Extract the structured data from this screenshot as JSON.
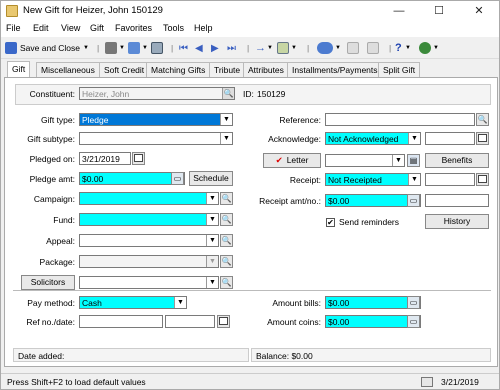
{
  "window": {
    "title": "New Gift for Heizer, John 150129",
    "minimize": "—",
    "maximize": "☐",
    "close": "✕"
  },
  "menu": [
    "File",
    "Edit",
    "View",
    "Gift",
    "Favorites",
    "Tools",
    "Help"
  ],
  "toolbar": {
    "save_close": "Save and Close"
  },
  "tabs": [
    "Gift",
    "Miscellaneous",
    "Soft Credit",
    "Matching Gifts",
    "Tribute",
    "Attributes",
    "Installments/Payments",
    "Split Gift"
  ],
  "constituent": {
    "label": "Constituent:",
    "value": "Heizer, John",
    "id_label": "ID:",
    "id_value": "150129"
  },
  "left": {
    "gift_type": {
      "label": "Gift type:",
      "value": "Pledge"
    },
    "gift_subtype": {
      "label": "Gift subtype:",
      "value": ""
    },
    "pledged_on": {
      "label": "Pledged on:",
      "value": "3/21/2019"
    },
    "pledge_amt": {
      "label": "Pledge amt:",
      "value": "$0.00",
      "schedule": "Schedule"
    },
    "campaign": {
      "label": "Campaign:",
      "value": ""
    },
    "fund": {
      "label": "Fund:",
      "value": ""
    },
    "appeal": {
      "label": "Appeal:",
      "value": ""
    },
    "package": {
      "label": "Package:",
      "value": ""
    },
    "solicitors": {
      "label": "Solicitors",
      "value": ""
    }
  },
  "right": {
    "reference": {
      "label": "Reference:",
      "value": ""
    },
    "acknowledge": {
      "label": "Acknowledge:",
      "value": "Not Acknowledged",
      "date": ""
    },
    "letter": {
      "label": "Letter",
      "value": "",
      "benefits": "Benefits"
    },
    "receipt": {
      "label": "Receipt:",
      "value": "Not Receipted",
      "date": ""
    },
    "receipt_amt": {
      "label": "Receipt amt/no.:",
      "value": "$0.00",
      "no": ""
    },
    "send_reminders": {
      "label": "Send reminders",
      "checked": true,
      "history": "History"
    }
  },
  "payment": {
    "pay_method": {
      "label": "Pay method:",
      "value": "Cash"
    },
    "ref_date": {
      "label": "Ref no./date:",
      "value": "",
      "date": ""
    },
    "amount_bills": {
      "label": "Amount bills:",
      "value": "$0.00"
    },
    "amount_coins": {
      "label": "Amount coins:",
      "value": "$0.00"
    }
  },
  "footer": {
    "date_added": "Date added:",
    "balance": "Balance: $0.00"
  },
  "status": {
    "hint": "Press Shift+F2 to load default values",
    "date": "3/21/2019"
  }
}
